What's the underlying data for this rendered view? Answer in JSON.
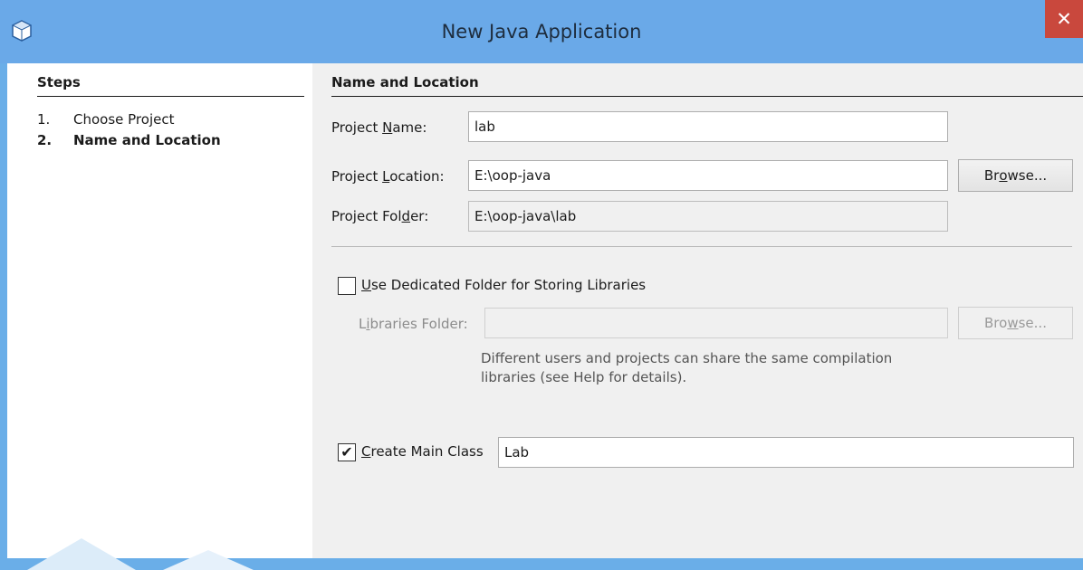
{
  "window": {
    "title": "New Java Application",
    "close_glyph": "✕"
  },
  "steps": {
    "title": "Steps",
    "items": [
      {
        "num": "1.",
        "label": "Choose Project",
        "current": false
      },
      {
        "num": "2.",
        "label": "Name and Location",
        "current": true
      }
    ]
  },
  "section": {
    "title": "Name and Location"
  },
  "form": {
    "project_name": {
      "label_pre": "Project ",
      "label_mn": "N",
      "label_post": "ame:",
      "value": "lab"
    },
    "project_location": {
      "label_pre": "Project ",
      "label_mn": "L",
      "label_post": "ocation:",
      "value": "E:\\oop-java"
    },
    "project_folder": {
      "label_pre": "Project Fol",
      "label_mn": "d",
      "label_post": "er:",
      "value": "E:\\oop-java\\lab"
    },
    "browse_location": {
      "pre": "Br",
      "mn": "o",
      "post": "wse..."
    },
    "dedicated_folder": {
      "checked": false,
      "label_mn": "U",
      "label_post": "se Dedicated Folder for Storing Libraries"
    },
    "libraries_folder": {
      "label_pre": "L",
      "label_mn": "i",
      "label_post": "braries Folder:",
      "value": ""
    },
    "browse_libraries": {
      "pre": "Bro",
      "mn": "w",
      "post": "se..."
    },
    "hint_line1": "Different users and projects can share the same compilation",
    "hint_line2": "libraries (see Help for details).",
    "create_main_class": {
      "checked": true,
      "check_glyph": "✔",
      "label_mn": "C",
      "label_post": "reate Main Class",
      "value": "Lab"
    }
  }
}
